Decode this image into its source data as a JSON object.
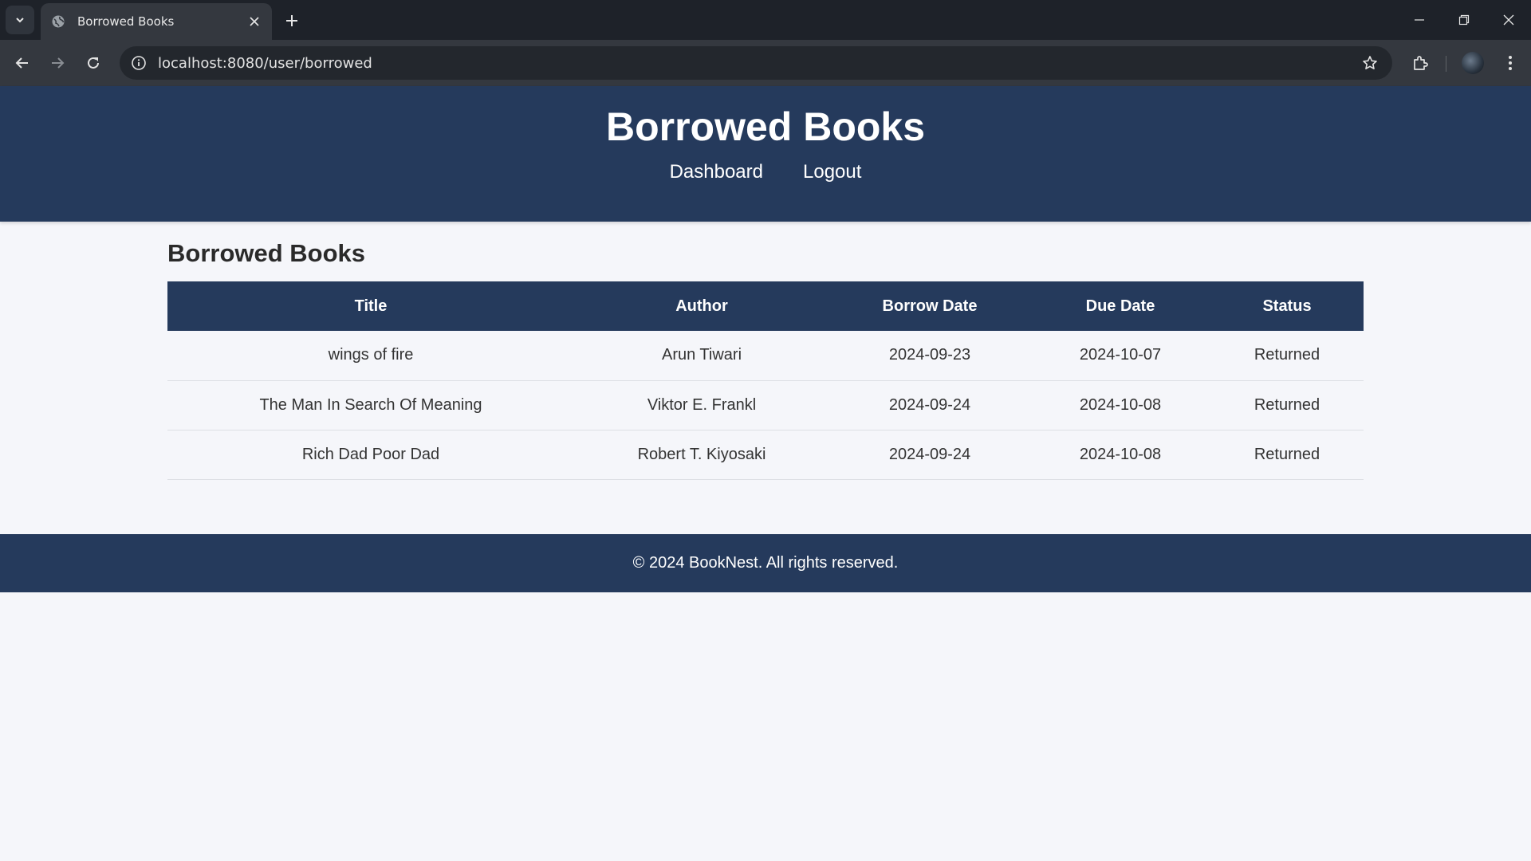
{
  "browser": {
    "tab_title": "Borrowed Books",
    "url": "localhost:8080/user/borrowed"
  },
  "header": {
    "title": "Borrowed Books",
    "nav": [
      {
        "label": "Dashboard"
      },
      {
        "label": "Logout"
      }
    ]
  },
  "main": {
    "section_title": "Borrowed Books",
    "columns": [
      "Title",
      "Author",
      "Borrow Date",
      "Due Date",
      "Status"
    ],
    "rows": [
      {
        "title": "wings of fire",
        "author": "Arun Tiwari",
        "borrow_date": "2024-09-23",
        "due_date": "2024-10-07",
        "status": "Returned"
      },
      {
        "title": "The Man In Search Of Meaning",
        "author": "Viktor E. Frankl",
        "borrow_date": "2024-09-24",
        "due_date": "2024-10-08",
        "status": "Returned"
      },
      {
        "title": "Rich Dad Poor Dad",
        "author": "Robert T. Kiyosaki",
        "borrow_date": "2024-09-24",
        "due_date": "2024-10-08",
        "status": "Returned"
      }
    ]
  },
  "footer": {
    "text": "© 2024 BookNest. All rights reserved."
  },
  "colors": {
    "header_bg": "#253a5c",
    "page_bg": "#f5f6fa"
  }
}
